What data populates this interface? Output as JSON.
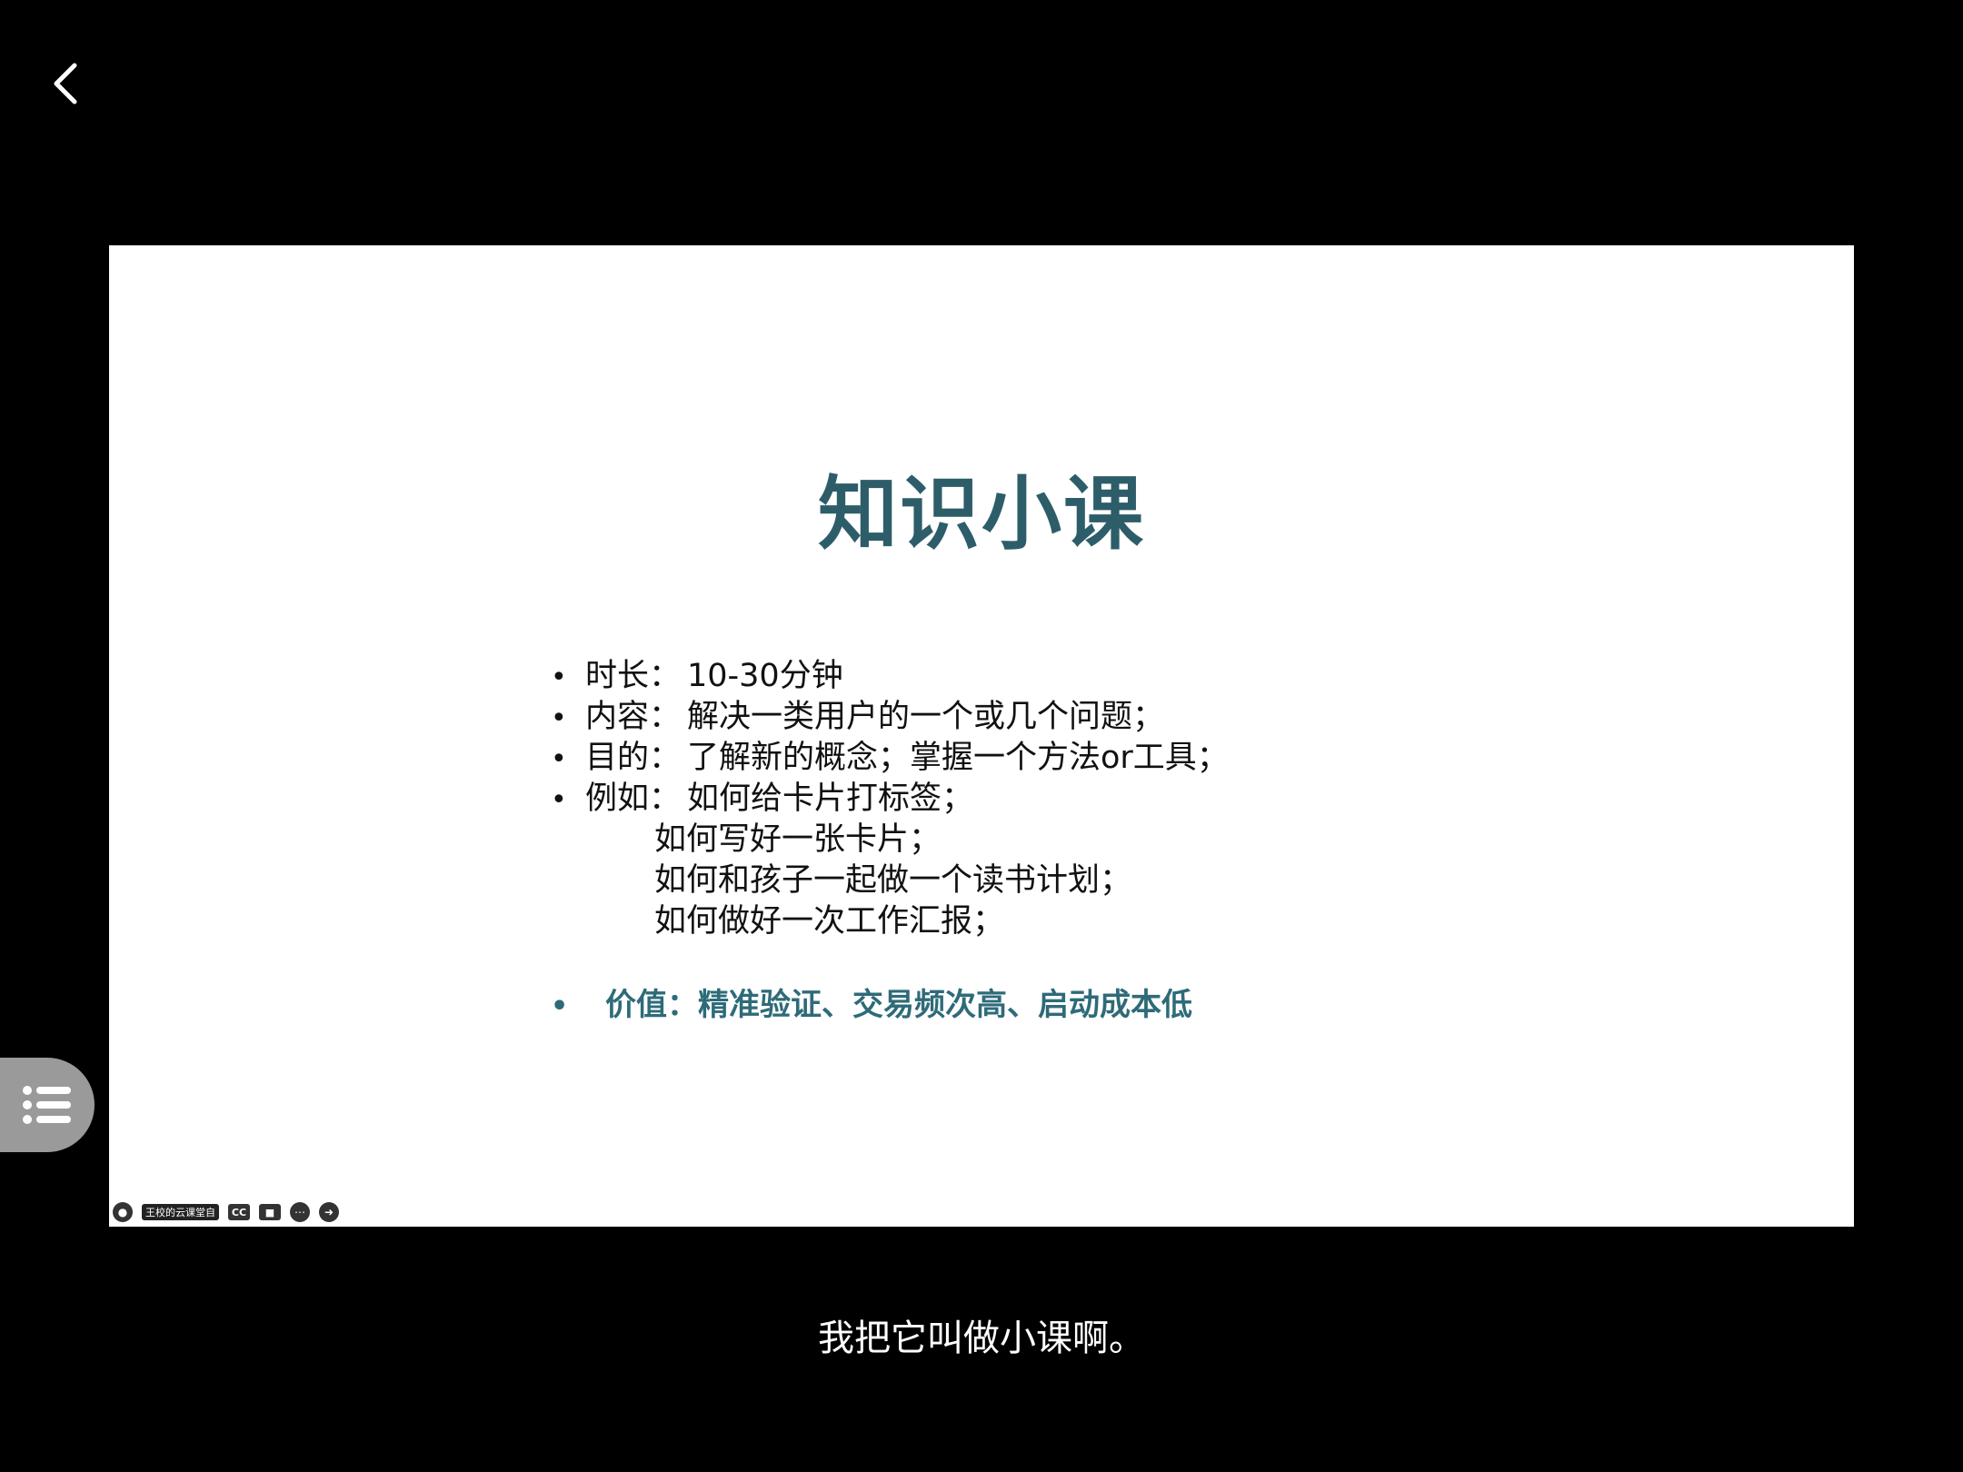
{
  "slide": {
    "title": "知识小课",
    "bullets": [
      {
        "label": "时长：",
        "value": "10-30分钟"
      },
      {
        "label": "内容：",
        "value": "解决一类用户的一个或几个问题；"
      },
      {
        "label": "目的：",
        "value": "了解新的概念；掌握一个方法or工具；"
      },
      {
        "label": "例如：",
        "value": "如何给卡片打标签；"
      }
    ],
    "examples": [
      "如何写好一张卡片；",
      "如何和孩子一起做一个读书计划；",
      "如何做好一次工作汇报；"
    ],
    "value_line": "价值：精准验证、交易频次高、启动成本低",
    "bullet_char": "•",
    "toolbar": {
      "label": "王校的云课堂自",
      "cc": "CC"
    }
  },
  "subtitle": "我把它叫做小课啊。",
  "colors": {
    "title": "#2e5d6a",
    "value_line": "#2e6b78",
    "side_menu": "#9a9a9a"
  },
  "icons": {
    "back": "chevron-left-icon",
    "menu": "list-icon"
  }
}
